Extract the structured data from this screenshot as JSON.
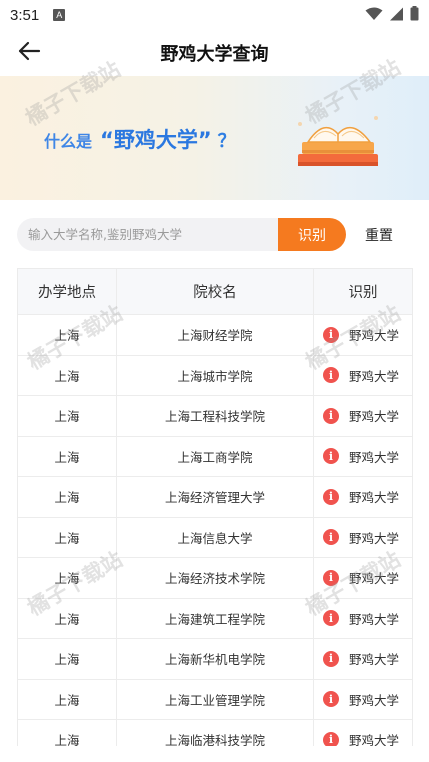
{
  "status_bar": {
    "time": "3:51",
    "notif_badge": "A"
  },
  "header": {
    "title": "野鸡大学查询"
  },
  "banner": {
    "prefix": "什么是",
    "highlight": "“野鸡大学”",
    "suffix": "？"
  },
  "search": {
    "placeholder": "输入大学名称,鉴别野鸡大学",
    "value": "",
    "identify_label": "识别",
    "reset_label": "重置"
  },
  "table": {
    "headers": [
      "办学地点",
      "院校名",
      "识别"
    ],
    "rows": [
      {
        "location": "上海",
        "name": "上海财经学院",
        "result": "野鸡大学"
      },
      {
        "location": "上海",
        "name": "上海城市学院",
        "result": "野鸡大学"
      },
      {
        "location": "上海",
        "name": "上海工程科技学院",
        "result": "野鸡大学"
      },
      {
        "location": "上海",
        "name": "上海工商学院",
        "result": "野鸡大学"
      },
      {
        "location": "上海",
        "name": "上海经济管理大学",
        "result": "野鸡大学"
      },
      {
        "location": "上海",
        "name": "上海信息大学",
        "result": "野鸡大学"
      },
      {
        "location": "上海",
        "name": "上海经济技术学院",
        "result": "野鸡大学"
      },
      {
        "location": "上海",
        "name": "上海建筑工程学院",
        "result": "野鸡大学"
      },
      {
        "location": "上海",
        "name": "上海新华机电学院",
        "result": "野鸡大学"
      },
      {
        "location": "上海",
        "name": "上海工业管理学院",
        "result": "野鸡大学"
      },
      {
        "location": "上海",
        "name": "上海临港科技学院",
        "result": "野鸡大学"
      }
    ]
  },
  "watermark": "橘子下载站",
  "colors": {
    "accent": "#f57a1f",
    "banner_text": "#2b78e0",
    "warning_icon": "#f0534e"
  }
}
